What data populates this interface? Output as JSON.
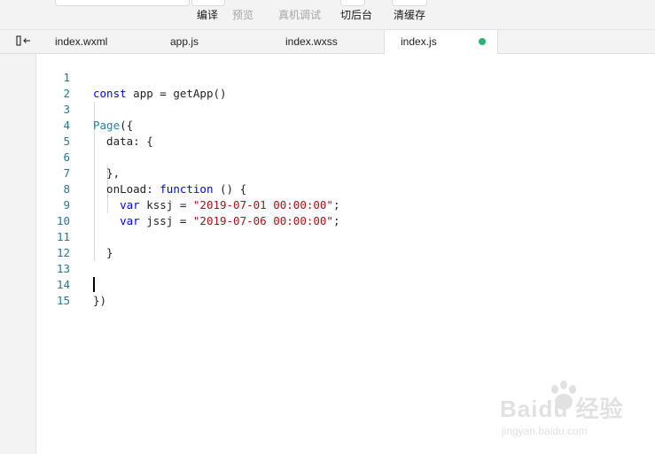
{
  "toolbar": {
    "buttons": [
      {
        "label": "编译",
        "enabled": true
      },
      {
        "label": "预览",
        "enabled": false
      },
      {
        "label": "真机调试",
        "enabled": false
      },
      {
        "label": "切后台",
        "enabled": true
      },
      {
        "label": "清缓存",
        "enabled": true
      }
    ]
  },
  "tabs": [
    {
      "label": "index.wxml",
      "active": false
    },
    {
      "label": "app.js",
      "active": false
    },
    {
      "label": "index.wxss",
      "active": false
    },
    {
      "label": "index.js",
      "active": true,
      "modified": true
    }
  ],
  "editor": {
    "file": "index.js",
    "lines": [
      {
        "n": "1",
        "text": "const app = getApp()"
      },
      {
        "n": "2",
        "text": ""
      },
      {
        "n": "3",
        "text": "Page({"
      },
      {
        "n": "4",
        "text": "  data: {"
      },
      {
        "n": "5",
        "text": ""
      },
      {
        "n": "6",
        "text": "  },"
      },
      {
        "n": "7",
        "text": "  onLoad: function () {"
      },
      {
        "n": "8",
        "text": "    var kssj = \"2019-07-01 00:00:00\";"
      },
      {
        "n": "9",
        "text": "    var jssj = \"2019-07-06 00:00:00\";"
      },
      {
        "n": "10",
        "text": ""
      },
      {
        "n": "11",
        "text": "  }"
      },
      {
        "n": "12",
        "text": ""
      },
      {
        "n": "13",
        "text": ""
      },
      {
        "n": "14",
        "text": "})"
      },
      {
        "n": "15",
        "text": ""
      }
    ],
    "cursor_line": "15"
  },
  "watermark": {
    "brand": "Baidu 经验",
    "url": "jingyan.baidu.com"
  },
  "colors": {
    "keyword": "#0000ff",
    "string": "#a31515",
    "line_number": "#237893",
    "modified_dot": "#26b573"
  },
  "icons": {
    "sidebar_toggle": "collapse-sidebar-icon"
  }
}
